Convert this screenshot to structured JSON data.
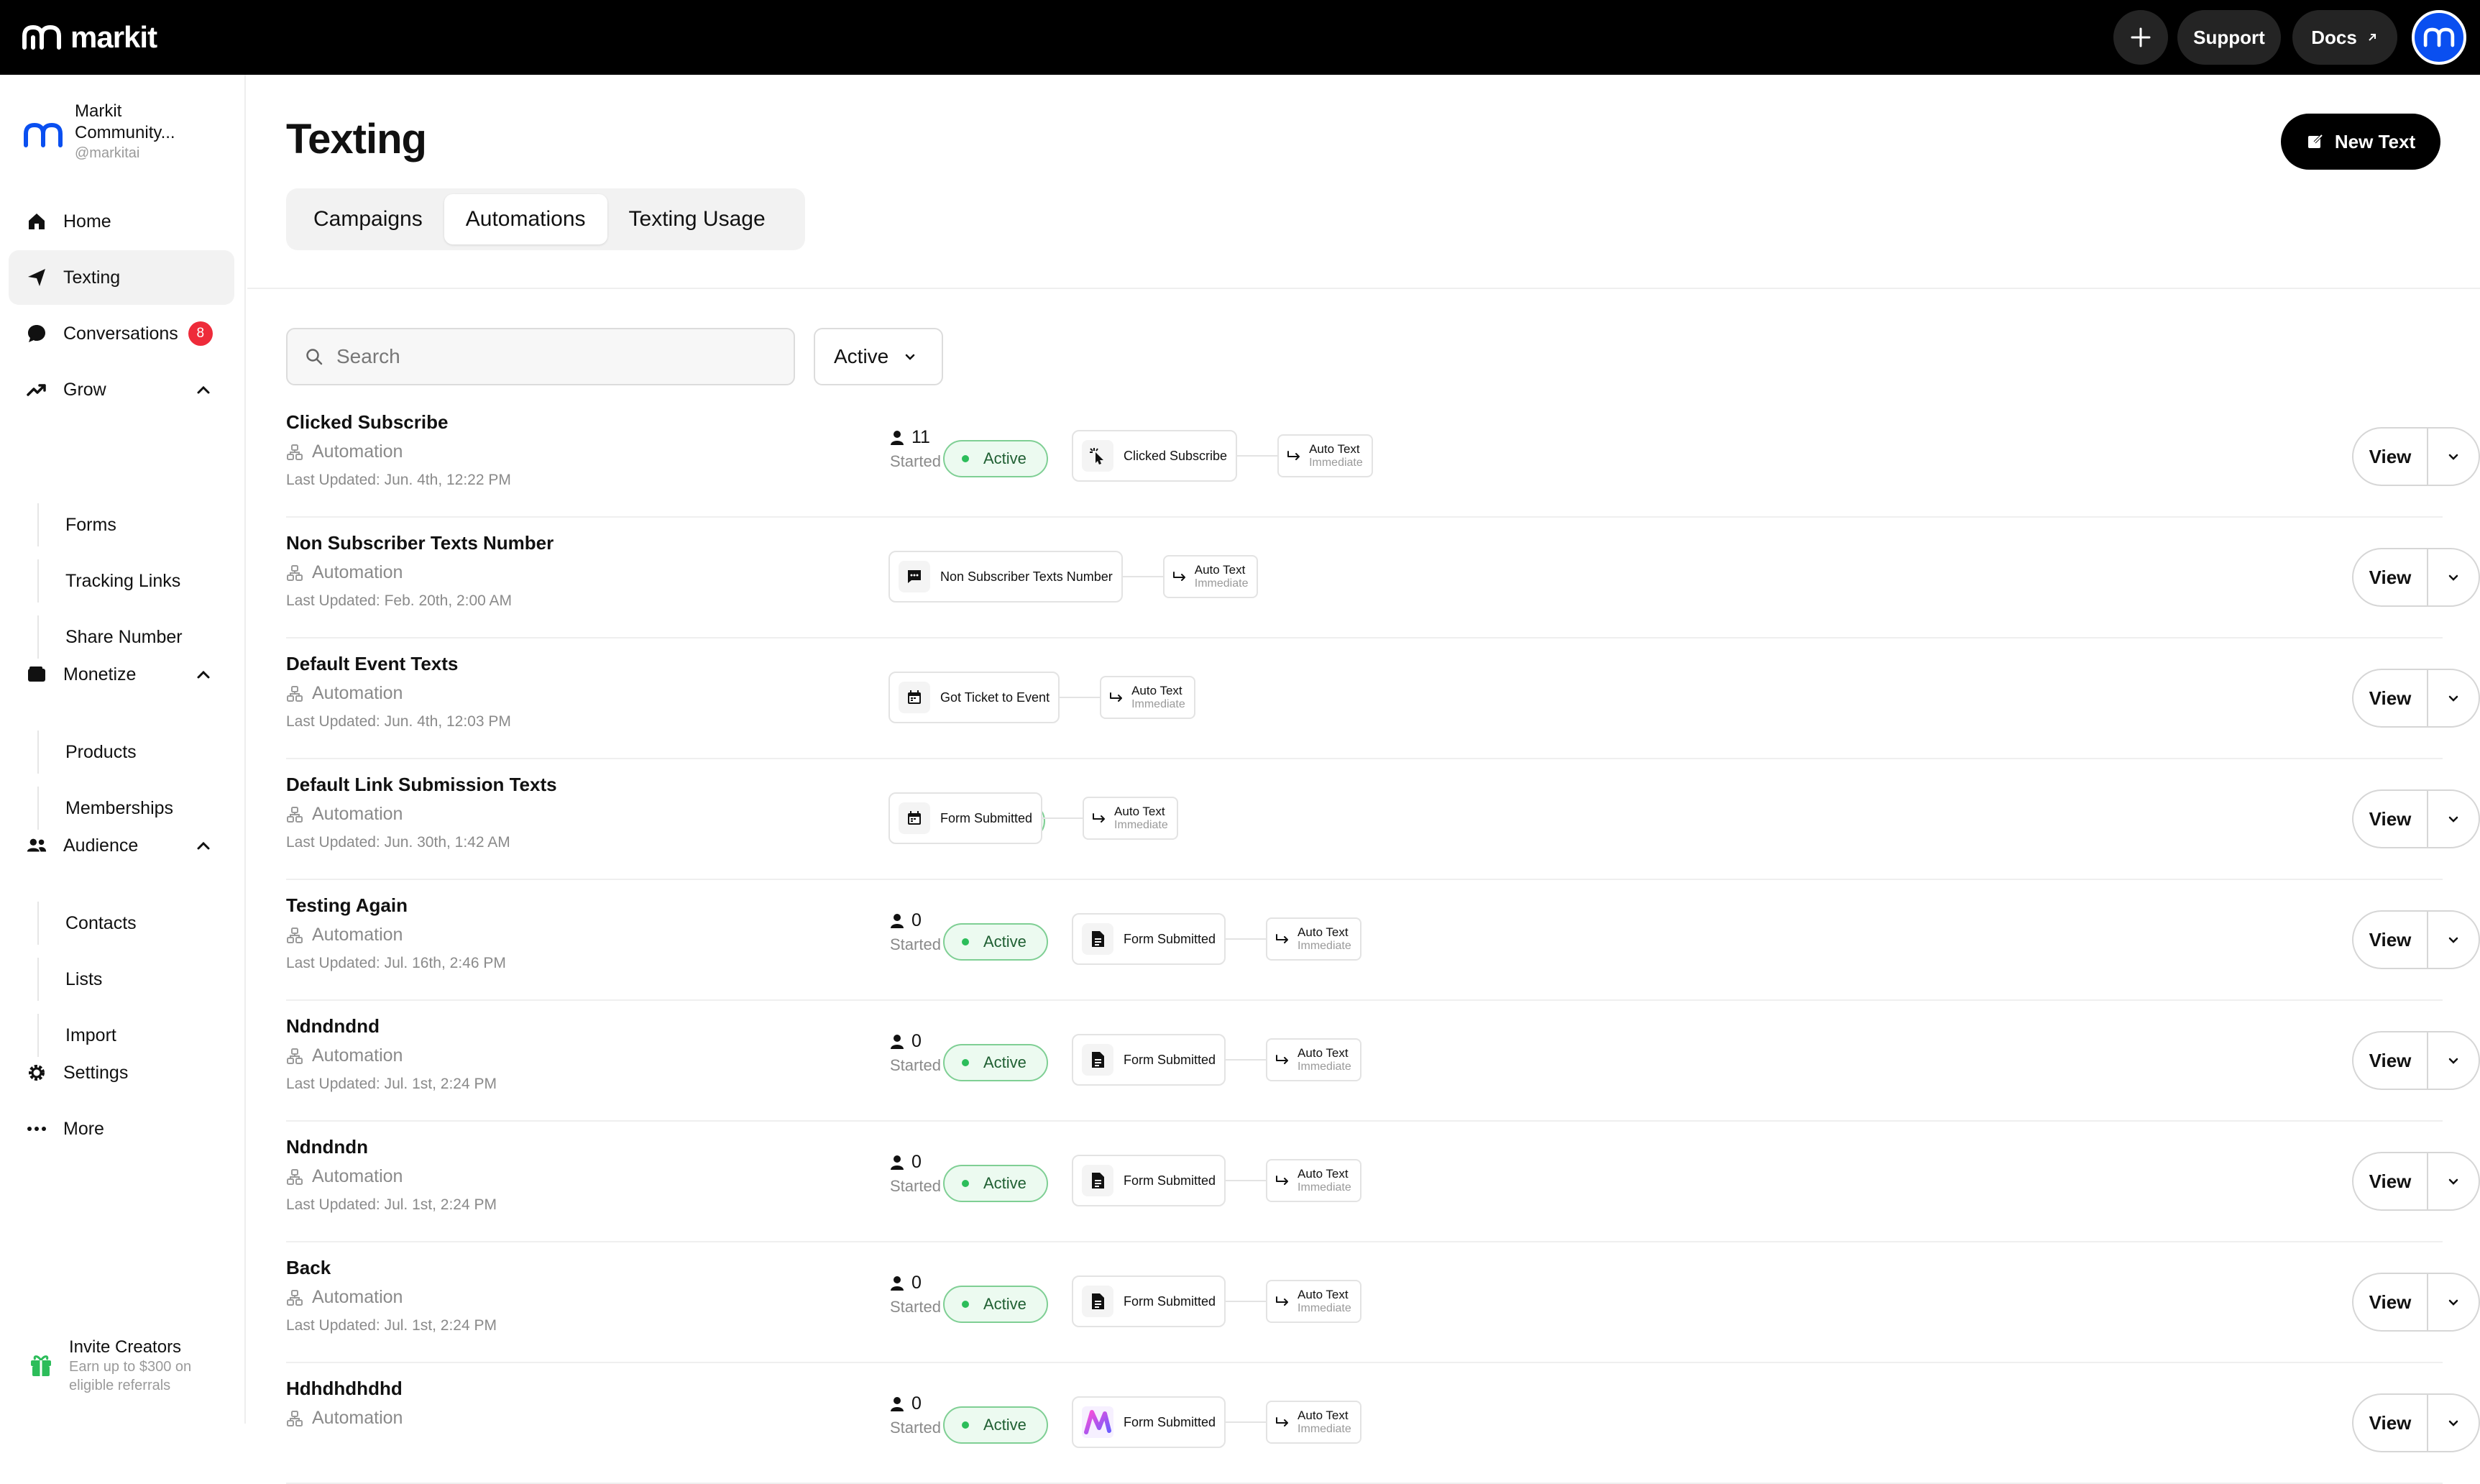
{
  "topbar": {
    "brand": "markit",
    "support_label": "Support",
    "docs_label": "Docs"
  },
  "sidebar": {
    "org_name": "Markit Community...",
    "org_handle": "@markitai",
    "items": {
      "home": "Home",
      "texting": "Texting",
      "conversations": "Conversations",
      "conversations_badge": "8",
      "grow": "Grow",
      "forms": "Forms",
      "tracking_links": "Tracking Links",
      "share_number": "Share Number",
      "monetize": "Monetize",
      "products": "Products",
      "memberships": "Memberships",
      "audience": "Audience",
      "contacts": "Contacts",
      "lists": "Lists",
      "import": "Import",
      "settings": "Settings",
      "more": "More"
    },
    "invite_title": "Invite Creators",
    "invite_sub": "Earn up to $300 on eligible referrals"
  },
  "main": {
    "title": "Texting",
    "new_text_label": "New Text",
    "tabs": [
      "Campaigns",
      "Automations",
      "Texting Usage"
    ],
    "active_tab": "Automations",
    "search_placeholder": "Search",
    "filter_value": "Active",
    "view_label": "View",
    "started_label": "Started",
    "type_label": "Automation",
    "status_label": "Active",
    "step_title": "Auto Text",
    "step_sub": "Immediate",
    "rows": [
      {
        "title": "Clicked Subscribe",
        "updated": "Last Updated: Jun. 4th, 12:22 PM",
        "started": "11",
        "trigger": "Clicked Subscribe"
      },
      {
        "title": "Non Subscriber Texts Number",
        "updated": "Last Updated: Feb. 20th, 2:00 AM",
        "started": "",
        "trigger": "Non Subscriber Texts Number"
      },
      {
        "title": "Default Event Texts",
        "updated": "Last Updated: Jun. 4th, 12:03 PM",
        "started": "",
        "trigger": "Got Ticket to Event"
      },
      {
        "title": "Default Link Submission Texts",
        "updated": "Last Updated: Jun. 30th, 1:42 AM",
        "started": "",
        "trigger": "Form Submitted"
      },
      {
        "title": "Testing Again",
        "updated": "Last Updated: Jul. 16th, 2:46 PM",
        "started": "0",
        "trigger": "Form Submitted"
      },
      {
        "title": "Ndndndnd",
        "updated": "Last Updated: Jul. 1st, 2:24 PM",
        "started": "0",
        "trigger": "Form Submitted"
      },
      {
        "title": "Ndndndn",
        "updated": "Last Updated: Jul. 1st, 2:24 PM",
        "started": "0",
        "trigger": "Form Submitted"
      },
      {
        "title": "Back",
        "updated": "Last Updated: Jul. 1st, 2:24 PM",
        "started": "0",
        "trigger": "Form Submitted"
      },
      {
        "title": "Hdhdhdhdhd",
        "updated": "",
        "started": "0",
        "trigger": "Form Submitted"
      }
    ]
  },
  "colors": {
    "accent": "#0a4ff0",
    "active_green": "#2cbd5a",
    "badge_red": "#ee2b3a"
  },
  "icons": [
    "plus-icon",
    "external-link-icon",
    "home-icon",
    "send-icon",
    "chat-icon",
    "trend-icon",
    "wallet-icon",
    "people-icon",
    "gear-icon",
    "more-icon",
    "gift-icon",
    "search-icon",
    "chevron-down-icon",
    "user-icon",
    "cursor-click-icon",
    "message-icon",
    "calendar-icon",
    "document-icon",
    "reply-arrow-icon"
  ]
}
